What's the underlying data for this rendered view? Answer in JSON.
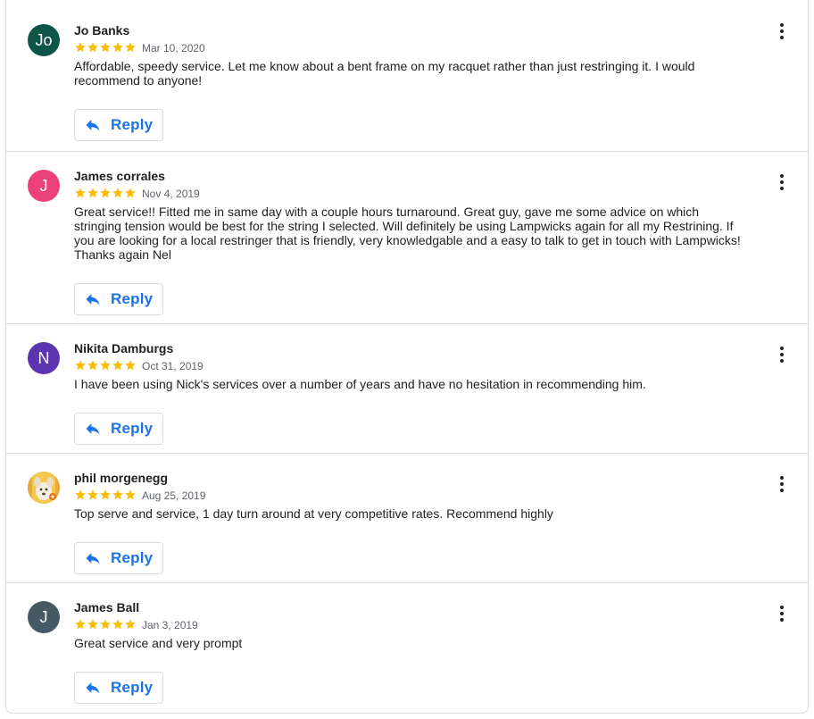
{
  "reviews": [
    {
      "author": "Jo Banks",
      "avatar_text": "Jo",
      "avatar_color": "#0d5546",
      "rating": 5,
      "date": "Mar 10, 2020",
      "text": "Affordable, speedy service. Let me know about a bent frame on my racquet rather than just restringing it. I would recommend to anyone!",
      "reply_label": "Reply"
    },
    {
      "author": "James corrales",
      "avatar_text": "J",
      "avatar_color": "#ec407a",
      "rating": 5,
      "date": "Nov 4, 2019",
      "text": "Great service!! Fitted me in same day with a couple hours turnaround. Great guy, gave me some advice on which stringing tension would be best for the string I selected. Will definitely be using Lampwicks again for all my Restrining. If you are looking for a local restringer that is friendly, very knowledgable and a easy to talk to get in touch with Lampwicks! Thanks again Nel",
      "reply_label": "Reply"
    },
    {
      "author": "Nikita Damburgs",
      "avatar_text": "N",
      "avatar_color": "#5e35b1",
      "rating": 5,
      "date": "Oct 31, 2019",
      "text": "I have been using Nick's services over a number of years and have no hesitation in recommending him.",
      "reply_label": "Reply"
    },
    {
      "author": "phil morgenegg",
      "avatar_text": "",
      "avatar_color": "#f2c94c",
      "rating": 5,
      "date": "Aug 25, 2019",
      "text": "Top serve and service, 1 day turn around at very competitive rates. Recommend highly",
      "reply_label": "Reply"
    },
    {
      "author": "James Ball",
      "avatar_text": "J",
      "avatar_color": "#455a64",
      "rating": 5,
      "date": "Jan 3, 2019",
      "text": "Great service and very prompt",
      "reply_label": "Reply"
    }
  ],
  "colors": {
    "star": "#fbbc04",
    "accent": "#1a73e8",
    "border": "#dadce0",
    "muted_text": "#5f6368"
  },
  "icons": {
    "star": "star-icon",
    "reply": "reply-icon",
    "menu": "more-vert-icon"
  }
}
